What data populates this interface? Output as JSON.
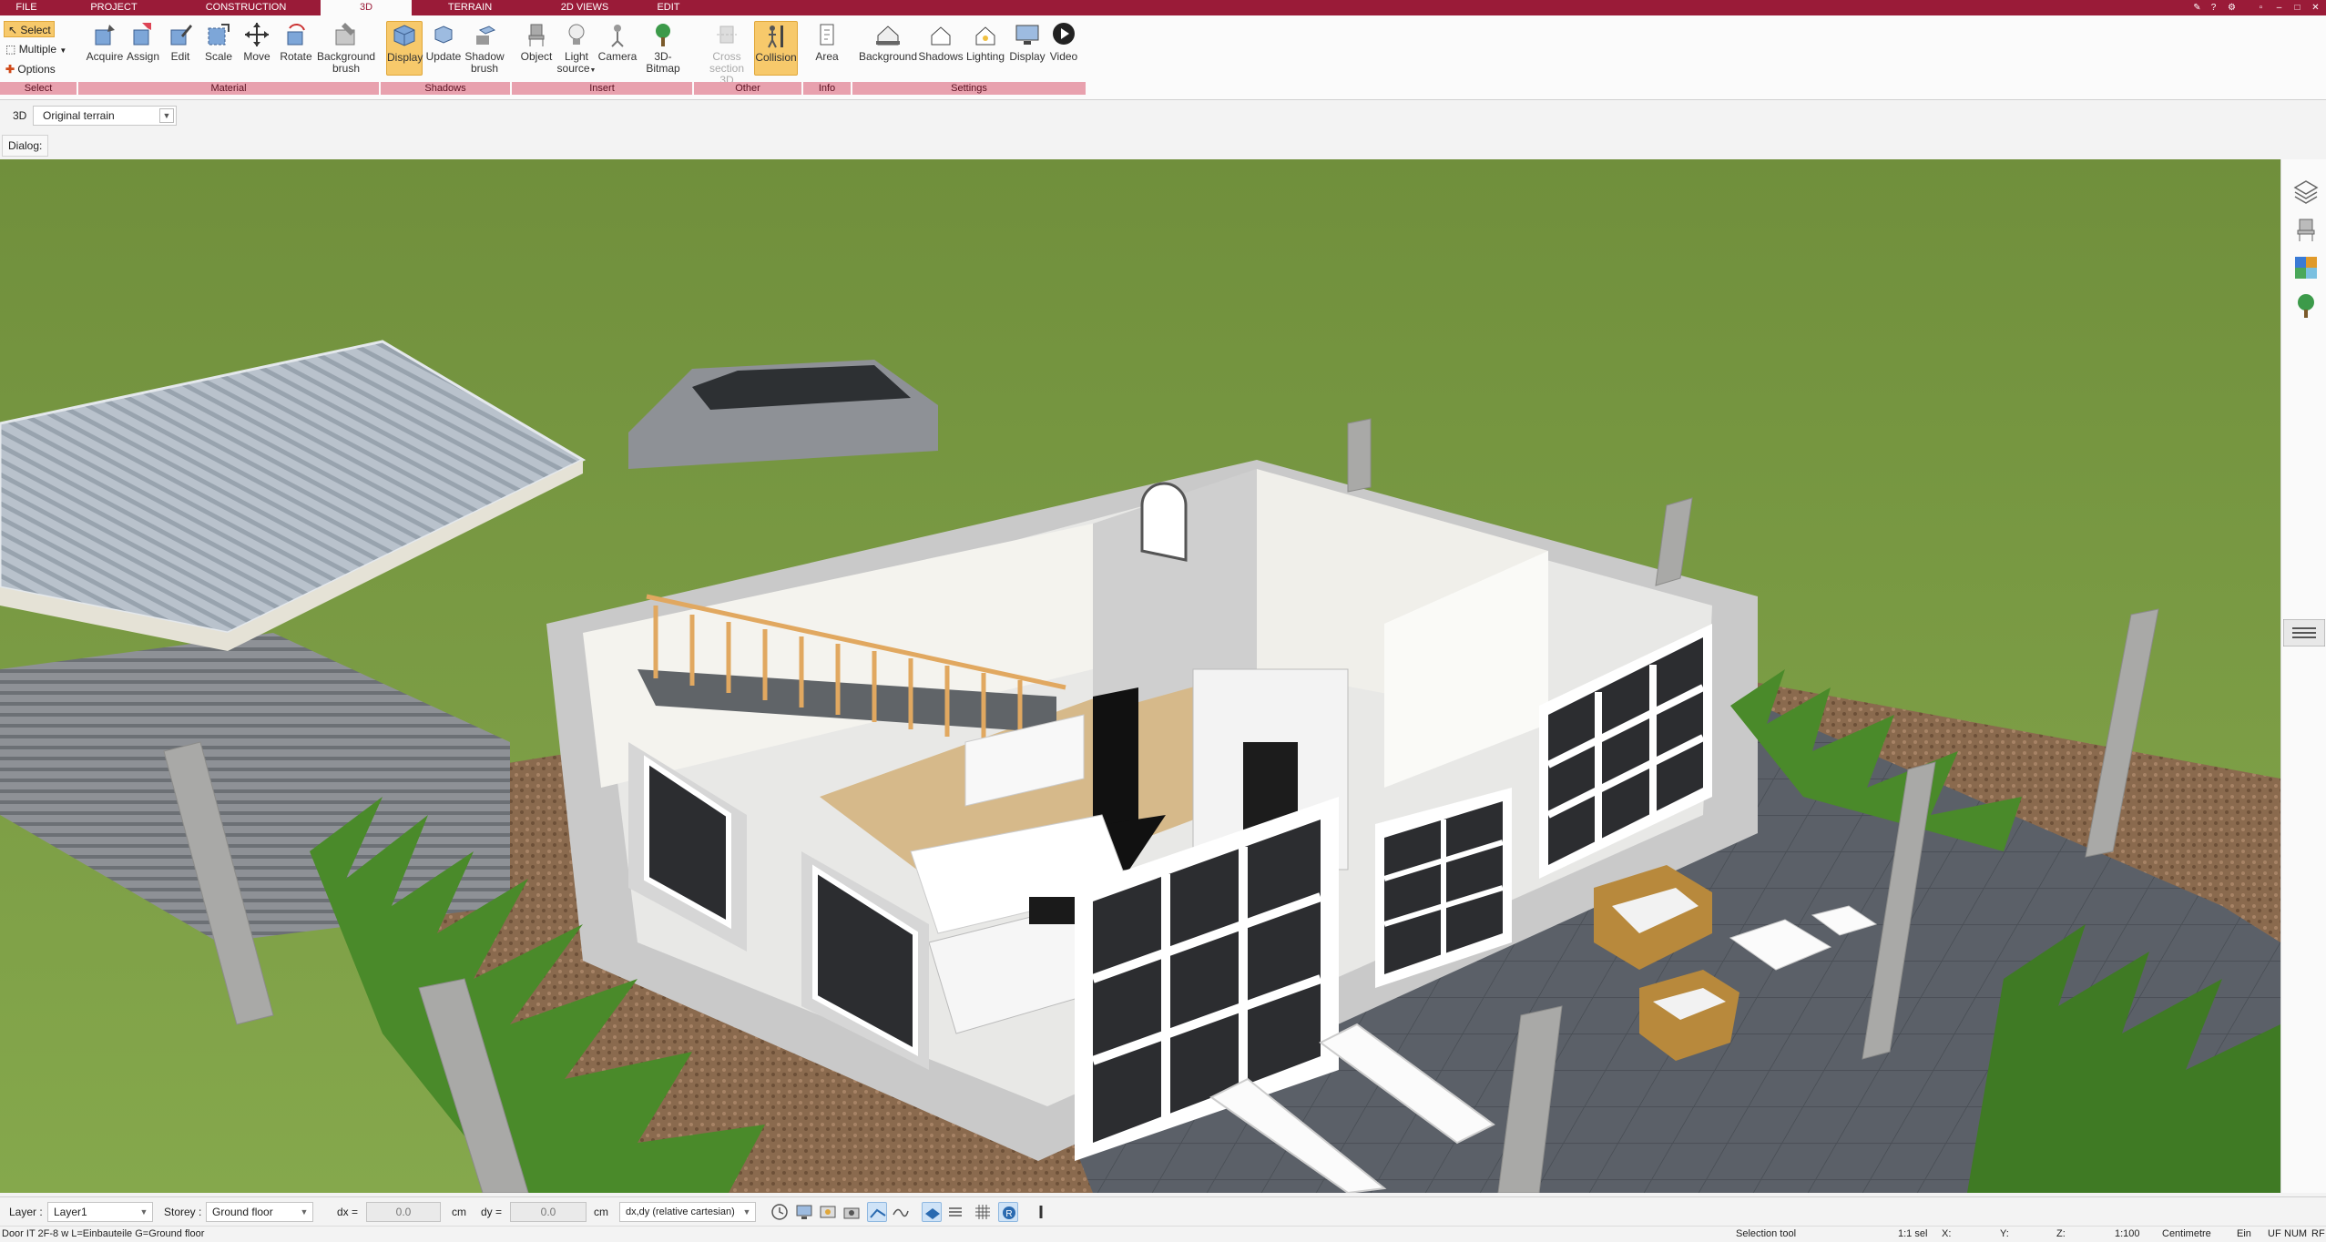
{
  "menu": {
    "tabs": [
      {
        "label": "FILE"
      },
      {
        "label": "PROJECT"
      },
      {
        "label": "CONSTRUCTION"
      },
      {
        "label": "3D"
      },
      {
        "label": "TERRAIN"
      },
      {
        "label": "2D VIEWS"
      },
      {
        "label": "EDIT"
      }
    ],
    "active_tab": "3D",
    "accent_color": "#9a1b38"
  },
  "ribbon": {
    "select_group": {
      "select": "Select",
      "multiple": "Multiple",
      "options": "Options",
      "label": "Select"
    },
    "material": {
      "label": "Material",
      "buttons": [
        "Acquire",
        "Assign",
        "Edit",
        "Scale",
        "Move",
        "Rotate",
        "Background",
        "brush"
      ]
    },
    "shadows": {
      "label": "Shadows",
      "display": "Display",
      "update": "Update",
      "shadow": "Shadow",
      "shadow2": "brush"
    },
    "insert": {
      "label": "Insert",
      "object": "Object",
      "light": "Light",
      "light2": "source",
      "camera": "Camera",
      "bitmap": "3D-Bitmap"
    },
    "other": {
      "label": "Other",
      "cross": "Cross",
      "cross2": "section 3D",
      "collision": "Collision"
    },
    "info": {
      "label": "Info",
      "area": "Area"
    },
    "settings": {
      "label": "Settings",
      "background": "Background",
      "shadows": "Shadows",
      "lighting": "Lighting",
      "display": "Display",
      "video": "Video"
    }
  },
  "viewbar": {
    "mode": "3D",
    "terrain": "Original terrain"
  },
  "dialog": {
    "label": "Dialog:"
  },
  "bottom": {
    "layer_label": "Layer :",
    "layer_value": "Layer1",
    "storey_label": "Storey :",
    "storey_value": "Ground floor",
    "dx_label": "dx =",
    "dx_value": "0.0",
    "dx_unit": "cm",
    "dy_label": "dy =",
    "dy_value": "0.0",
    "dy_unit": "cm",
    "coord_mode": "dx,dy (relative cartesian)"
  },
  "status": {
    "hint": "Door IT 2F-8 w L=Einbauteile G=Ground floor",
    "tool": "Selection tool",
    "sel": "1:1 sel",
    "x": "X:",
    "y": "Y:",
    "z": "Z:",
    "scale": "1:100",
    "unit": "Centimetre",
    "ein": "Ein",
    "uf": "UF",
    "num": "NUM",
    "rf": "RF"
  }
}
